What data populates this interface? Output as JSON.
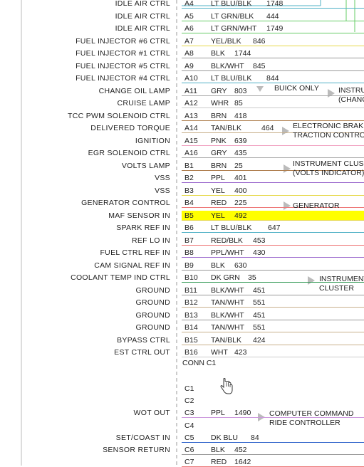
{
  "rows": [
    {
      "fn": "IDLE AIR CTRL",
      "pin": "A4",
      "color": "LT BLU/BLK",
      "circuit": "1748",
      "wire": "#4fb0c6"
    },
    {
      "fn": "IDLE AIR CTRL",
      "pin": "A5",
      "color": "LT GRN/BLK",
      "circuit": "444",
      "wire": "#66cc66"
    },
    {
      "fn": "IDLE AIR CTRL",
      "pin": "A6",
      "color": "LT GRN/WHT",
      "circuit": "1749",
      "wire": "#66cc66"
    },
    {
      "fn": "FUEL INJECTOR #6 CTRL",
      "pin": "A7",
      "color": "YEL/BLK",
      "circuit": "846",
      "wire": "#e6d84a"
    },
    {
      "fn": "FUEL INJECTOR #1 CTRL",
      "pin": "A8",
      "color": "BLK",
      "circuit": "1744",
      "wire": "#999999"
    },
    {
      "fn": "FUEL INJECTOR #5 CTRL",
      "pin": "A9",
      "color": "BLK/WHT",
      "circuit": "845",
      "wire": "#999999"
    },
    {
      "fn": "FUEL INJECTOR #4 CTRL",
      "pin": "A10",
      "color": "LT BLU/BLK",
      "circuit": "844",
      "wire": "#4fb0c6"
    },
    {
      "fn": "CHANGE OIL LAMP",
      "pin": "A11",
      "color": "GRY",
      "circuit": "803",
      "wire": "#aaaaaa"
    },
    {
      "fn": "CRUISE LAMP",
      "pin": "A12",
      "color": "WHR",
      "circuit": "85",
      "wire": "#cccccc"
    },
    {
      "fn": "TCC PWM SOLENOID CTRL",
      "pin": "A13",
      "color": "BRN",
      "circuit": "418",
      "wire": "#b08050"
    },
    {
      "fn": "DELIVERED TORQUE",
      "pin": "A14",
      "color": "TAN/BLK",
      "circuit": "464",
      "wire": "#c8b08c"
    },
    {
      "fn": "IGNITION",
      "pin": "A15",
      "color": "PNK",
      "circuit": "639",
      "wire": "#f0a0c0"
    },
    {
      "fn": "EGR SOLENOID CTRL",
      "pin": "A16",
      "color": "GRY",
      "circuit": "435",
      "wire": "#aaaaaa"
    },
    {
      "fn": "VOLTS LAMP",
      "pin": "B1",
      "color": "BRN",
      "circuit": "25",
      "wire": "#b08050"
    },
    {
      "fn": "VSS",
      "pin": "B2",
      "color": "PPL",
      "circuit": "401",
      "wire": "#9966cc"
    },
    {
      "fn": "VSS",
      "pin": "B3",
      "color": "YEL",
      "circuit": "400",
      "wire": "#e6d84a"
    },
    {
      "fn": "GENERATOR CONTROL",
      "pin": "B4",
      "color": "RED",
      "circuit": "225",
      "wire": "#ee7777"
    },
    {
      "fn": "MAF SENSOR IN",
      "pin": "B5",
      "color": "YEL",
      "circuit": "492",
      "wire": "#e6d84a"
    },
    {
      "fn": "SPARK REF IN",
      "pin": "B6",
      "color": "LT BLU/BLK",
      "circuit": "647",
      "wire": "#4fb0c6"
    },
    {
      "fn": "REF LO IN",
      "pin": "B7",
      "color": "RED/BLK",
      "circuit": "453",
      "wire": "#ee7777"
    },
    {
      "fn": "FUEL CTRL REF IN",
      "pin": "B8",
      "color": "PPL/WHT",
      "circuit": "430",
      "wire": "#9966cc"
    },
    {
      "fn": "CAM SIGNAL REF IN",
      "pin": "B9",
      "color": "BLK",
      "circuit": "630",
      "wire": "#999999"
    },
    {
      "fn": "COOLANT TEMP IND CTRL",
      "pin": "B10",
      "color": "DK GRN",
      "circuit": "35",
      "wire": "#339955"
    },
    {
      "fn": "GROUND",
      "pin": "B11",
      "color": "BLK/WHT",
      "circuit": "451",
      "wire": "#999999"
    },
    {
      "fn": "GROUND",
      "pin": "B12",
      "color": "TAN/WHT",
      "circuit": "551",
      "wire": "#c8b08c"
    },
    {
      "fn": "GROUND",
      "pin": "B13",
      "color": "BLK/WHT",
      "circuit": "451",
      "wire": "#999999"
    },
    {
      "fn": "GROUND",
      "pin": "B14",
      "color": "TAN/WHT",
      "circuit": "551",
      "wire": "#c8b08c"
    },
    {
      "fn": "BYPASS CTRL",
      "pin": "B15",
      "color": "TAN/BLK",
      "circuit": "424",
      "wire": "#c8b08c"
    },
    {
      "fn": "EST CTRL OUT",
      "pin": "B16",
      "color": "WHT",
      "circuit": "423",
      "wire": "#cccccc"
    }
  ],
  "connector_label": "CONN C1",
  "c1_rows": [
    {
      "fn": "",
      "pin": "C1",
      "color": "",
      "circuit": ""
    },
    {
      "fn": "",
      "pin": "C2",
      "color": "",
      "circuit": ""
    },
    {
      "fn": "WOT OUT",
      "pin": "C3",
      "color": "PPL",
      "circuit": "1490",
      "wire": "#cc99dd"
    },
    {
      "fn": "",
      "pin": "C4",
      "color": "",
      "circuit": ""
    },
    {
      "fn": "SET/COAST IN",
      "pin": "C5",
      "color": "DK BLU",
      "circuit": "84",
      "wire": "#3366cc"
    },
    {
      "fn": "SENSOR RETURN",
      "pin": "C6",
      "color": "BLK",
      "circuit": "452",
      "wire": "#999999"
    },
    {
      "fn": "",
      "pin": "C7",
      "color": "RED",
      "circuit": "1642",
      "wire": "#ee7777"
    }
  ],
  "notes": {
    "buick_only": "BUICK ONLY",
    "instru_change_1": "INSTRU",
    "instru_change_2": "(CHANC",
    "ebrake_1": "ELECTRONIC BRAK",
    "ebrake_2": "TRACTION CONTRO",
    "instr_clus_1": "INSTRUMENT CLUS",
    "instr_clus_2": "(VOLTS INDICATOR)",
    "generator": "GENERATOR",
    "instr_cluster_1": "INSTRUMENT",
    "instr_cluster_2": "CLUSTER",
    "ccrc_1": "COMPUTER COMMAND",
    "ccrc_2": "RIDE CONTROLLER"
  },
  "highlight_pin": "B5",
  "highlight_color": "#ffff00"
}
